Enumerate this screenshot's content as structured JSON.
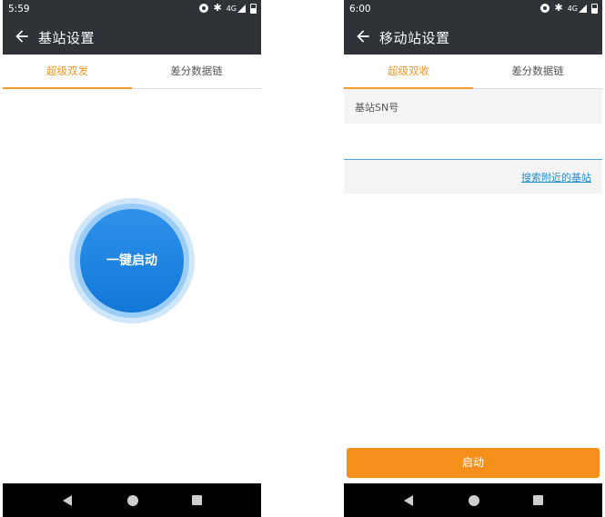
{
  "left_screen": {
    "status_bar": {
      "time": "5:59",
      "network": "4G"
    },
    "title": "基站设置",
    "tabs": [
      {
        "label": "超级双发",
        "active": true
      },
      {
        "label": "差分数据链",
        "active": false
      }
    ],
    "one_key_start_label": "一键启动"
  },
  "right_screen": {
    "status_bar": {
      "time": "6:00",
      "network": "4G"
    },
    "title": "移动站设置",
    "tabs": [
      {
        "label": "超级双收",
        "active": true
      },
      {
        "label": "差分数据链",
        "active": false
      }
    ],
    "sn_label": "基站SN号",
    "sn_value": "",
    "search_link": "搜索附近的基站",
    "start_label": "启动"
  },
  "icons": {
    "back": "arrow-left-icon",
    "status": [
      "data-saver-icon",
      "bluetooth-icon",
      "signal-icon",
      "battery-icon"
    ],
    "nav": [
      "nav-back-icon",
      "nav-home-icon",
      "nav-recents-icon"
    ]
  },
  "colors": {
    "header": "#2f3337",
    "accent_orange": "#f39a2e",
    "start_button": "#f5901c",
    "circle_button": "#1a84e0",
    "link_blue": "#1f8fd6"
  }
}
